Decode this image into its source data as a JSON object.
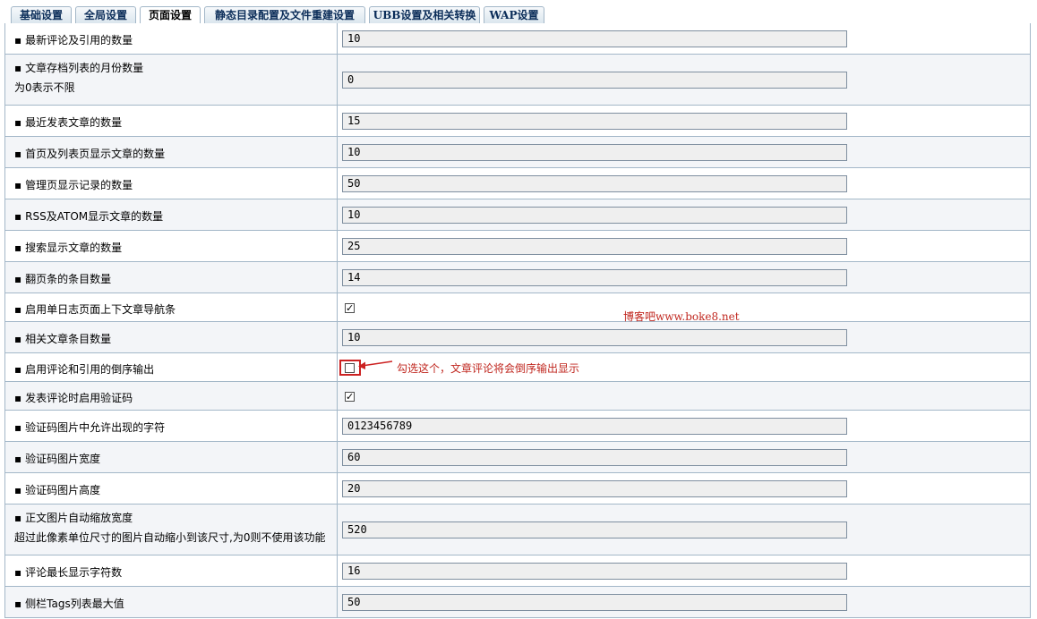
{
  "tabs": [
    {
      "label": "基础设置"
    },
    {
      "label": "全局设置"
    },
    {
      "label": "页面设置"
    },
    {
      "label": "静态目录配置及文件重建设置"
    },
    {
      "label": "UBB设置及相关转换"
    },
    {
      "label": "WAP设置"
    }
  ],
  "active_tab": "页面设置",
  "rows": [
    {
      "label": "最新评论及引用的数量",
      "value": "10"
    },
    {
      "label": "文章存档列表的月份数量",
      "sub": "为0表示不限",
      "value": "0"
    },
    {
      "label": "最近发表文章的数量",
      "value": "15"
    },
    {
      "label": "首页及列表页显示文章的数量",
      "value": "10"
    },
    {
      "label": "管理页显示记录的数量",
      "value": "50"
    },
    {
      "label": "RSS及ATOM显示文章的数量",
      "value": "10"
    },
    {
      "label": "搜索显示文章的数量",
      "value": "25"
    },
    {
      "label": "翻页条的条目数量",
      "value": "14"
    },
    {
      "label": "启用单日志页面上下文章导航条",
      "checked": true
    },
    {
      "label": "相关文章条目数量",
      "value": "10"
    },
    {
      "label": "启用评论和引用的倒序输出",
      "checked": false
    },
    {
      "label": "发表评论时启用验证码",
      "checked": true
    },
    {
      "label": "验证码图片中允许出现的字符",
      "value": "0123456789"
    },
    {
      "label": "验证码图片宽度",
      "value": "60"
    },
    {
      "label": "验证码图片高度",
      "value": "20"
    },
    {
      "label": "正文图片自动缩放宽度",
      "sub": "超过此像素单位尺寸的图片自动缩小到该尺寸,为0则不使用该功能",
      "value": "520"
    },
    {
      "label": "评论最长显示字符数",
      "value": "16"
    },
    {
      "label": "侧栏Tags列表最大值",
      "value": "50"
    }
  ],
  "annotations": {
    "watermark": "博客吧www.boke8.net",
    "note": "勾选这个，文章评论将会倒序输出显示",
    "note_color": "#c0271f"
  },
  "bullet": "▪"
}
